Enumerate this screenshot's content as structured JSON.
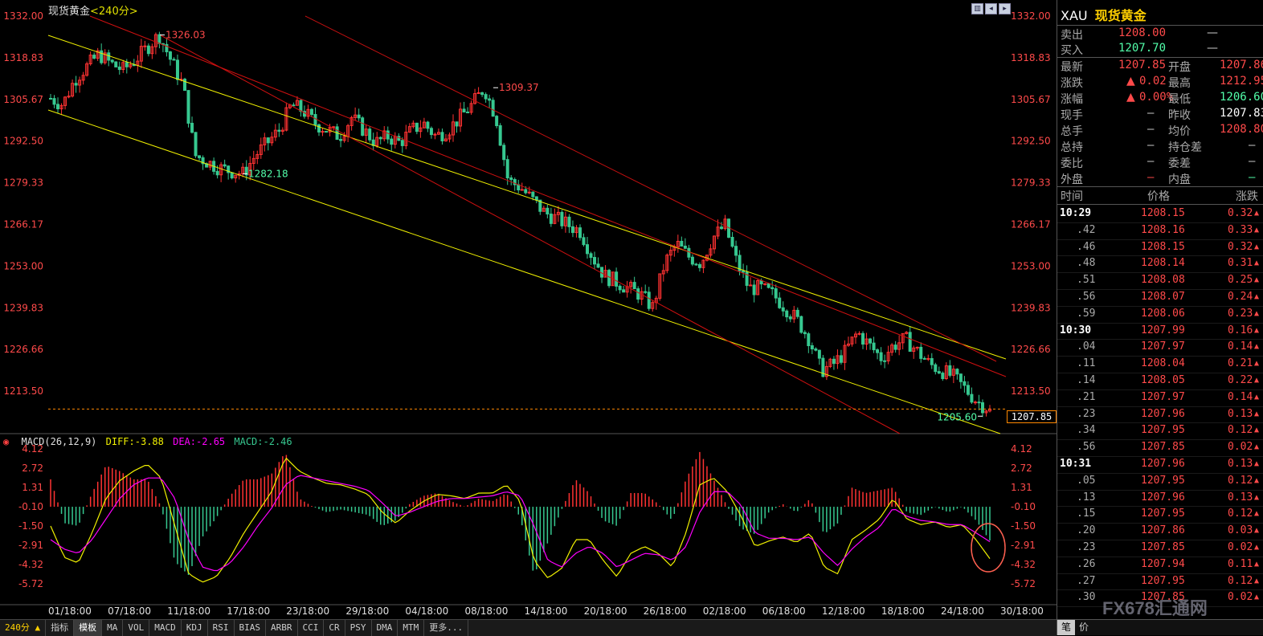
{
  "window": {
    "title": "现货黄金",
    "period": "<240分>",
    "toggle_icons": [
      "zoom-icon",
      "prev-icon",
      "next-icon"
    ]
  },
  "colors": {
    "up": "#ff3232",
    "down": "#36c890",
    "label_red": "#ff4a4a",
    "label_green": "#52ffaa",
    "trend_yellow": "#f0f000",
    "trend_red": "#d01010",
    "diff_line": "#f0f000",
    "dea_line": "#ff00ff",
    "price_cursor": "#ff8800"
  },
  "chart_data": [
    {
      "type": "candlestick",
      "title": "现货黄金<240分>",
      "yticks": [
        "1332.00",
        "1318.83",
        "1305.67",
        "1292.50",
        "1279.33",
        "1266.17",
        "1253.00",
        "1239.83",
        "1226.66",
        "1213.50"
      ],
      "ylim": [
        1200.34,
        1332.0
      ],
      "xticks": [
        "01/18:00",
        "07/18:00",
        "11/18:00",
        "17/18:00",
        "23/18:00",
        "29/18:00",
        "04/18:00",
        "08/18:00",
        "14/18:00",
        "20/18:00",
        "26/18:00",
        "02/18:00",
        "06/18:00",
        "12/18:00",
        "18/18:00",
        "24/18:00",
        "30/18:00"
      ],
      "annotations": [
        {
          "text": "1326.03",
          "value": 1326.03,
          "kind": "high"
        },
        {
          "text": "1282.18",
          "value": 1282.18,
          "kind": "low"
        },
        {
          "text": "1309.37",
          "value": 1309.37,
          "kind": "high"
        },
        {
          "text": "1205.60",
          "value": 1205.6,
          "kind": "low"
        }
      ],
      "current_price": "1207.85",
      "current_value": 1207.85,
      "price_path": [
        1306,
        1304,
        1312,
        1316,
        1320,
        1317,
        1315,
        1318,
        1322,
        1326.03,
        1318,
        1310,
        1288,
        1286,
        1284,
        1283,
        1282.18,
        1288,
        1292,
        1296,
        1304,
        1302,
        1298,
        1296,
        1294,
        1300,
        1296,
        1292,
        1294,
        1292,
        1296,
        1298,
        1294,
        1296,
        1300,
        1304,
        1309.37,
        1300,
        1280,
        1278,
        1274,
        1270,
        1268,
        1266,
        1264,
        1256,
        1250,
        1248,
        1246,
        1244,
        1240,
        1254,
        1260,
        1256,
        1254,
        1262,
        1266,
        1254,
        1246,
        1246,
        1244,
        1240,
        1236,
        1230,
        1220,
        1222,
        1226,
        1232,
        1228,
        1224,
        1228,
        1230,
        1226,
        1222,
        1220,
        1218,
        1214,
        1210,
        1207.85
      ],
      "trendlines": "two yellow descending channel lines and three red descending channel lines"
    },
    {
      "type": "macd",
      "indicator_name": "MACD(26,12,9)",
      "diff_label": "DIFF:",
      "diff": "-3.88",
      "dea_label": "DEA:",
      "dea": "-2.65",
      "macd_label": "MACD:",
      "macd": "-2.46",
      "yticks": [
        "4.12",
        "2.72",
        "1.31",
        "-0.10",
        "-1.50",
        "-2.91",
        "-4.32",
        "-5.72"
      ],
      "ylim": [
        -5.72,
        4.12
      ],
      "diff_path": [
        -1.5,
        -3.8,
        -4.2,
        -2.0,
        0.5,
        1.8,
        2.5,
        3.0,
        2.0,
        -1.5,
        -5.0,
        -5.6,
        -5.2,
        -3.8,
        -2.0,
        -0.5,
        1.0,
        3.5,
        2.5,
        2.0,
        1.6,
        1.5,
        1.2,
        0.8,
        -0.5,
        -1.3,
        -0.4,
        0.3,
        0.8,
        0.7,
        0.5,
        0.9,
        0.9,
        1.5,
        0.3,
        -4.0,
        -5.3,
        -4.6,
        -2.5,
        -2.5,
        -4.0,
        -5.2,
        -3.5,
        -3.0,
        -3.5,
        -4.5,
        -2.0,
        1.5,
        2.0,
        1.0,
        -0.8,
        -3.0,
        -2.6,
        -2.3,
        -2.7,
        -2.0,
        -4.5,
        -5.0,
        -2.5,
        -1.8,
        -1.0,
        0.5,
        -1.0,
        -1.4,
        -1.2,
        -1.6,
        -1.4,
        -2.5,
        -3.88
      ],
      "dea_path": [
        -2.5,
        -3.2,
        -3.5,
        -2.5,
        -1.0,
        0.5,
        1.5,
        2.0,
        2.0,
        0.5,
        -2.5,
        -4.5,
        -4.8,
        -4.2,
        -3.0,
        -1.5,
        -0.2,
        1.5,
        2.2,
        2.0,
        1.8,
        1.6,
        1.4,
        1.1,
        0.2,
        -0.8,
        -0.5,
        -0.1,
        0.3,
        0.5,
        0.5,
        0.6,
        0.7,
        1.0,
        0.7,
        -1.5,
        -4.0,
        -4.5,
        -3.5,
        -3.0,
        -3.5,
        -4.5,
        -4.0,
        -3.5,
        -3.6,
        -4.0,
        -3.0,
        -0.5,
        1.0,
        1.0,
        0.0,
        -2.0,
        -2.4,
        -2.4,
        -2.5,
        -2.3,
        -3.5,
        -4.4,
        -3.2,
        -2.3,
        -1.6,
        -0.2,
        -0.8,
        -1.1,
        -1.2,
        -1.4,
        -1.4,
        -2.0,
        -2.65
      ]
    }
  ],
  "right_panel": {
    "symbol": "XAU",
    "name": "现货黄金",
    "sell": {
      "label": "卖出",
      "price": "1208.00",
      "qty": "—"
    },
    "buy": {
      "label": "买入",
      "price": "1207.70",
      "qty": "—"
    },
    "stats": [
      {
        "label": "最新",
        "value": "1207.85",
        "label2": "开盘",
        "value2": "1207.86"
      },
      {
        "label": "涨跌",
        "value": "0.02",
        "arrow": "▲",
        "label2": "最高",
        "value2": "1212.95"
      },
      {
        "label": "涨幅",
        "value": "0.00%",
        "arrow": "▲",
        "label2": "最低",
        "value2": "1206.60"
      },
      {
        "label": "现手",
        "value": "—",
        "label2": "昨收",
        "value2": "1207.83"
      },
      {
        "label": "总手",
        "value": "—",
        "label2": "均价",
        "value2": "1208.80"
      },
      {
        "label": "总持",
        "value": "—",
        "label2": "持仓差",
        "value2": "—"
      },
      {
        "label": "委比",
        "value": "—",
        "label2": "委差",
        "value2": "—"
      },
      {
        "label": "外盘",
        "value": "—",
        "label2": "内盘",
        "value2": "—"
      }
    ],
    "tick_header": {
      "time": "时间",
      "price": "价格",
      "change": "涨跌"
    },
    "ticks": [
      {
        "time": "10:29",
        "price": "1208.15",
        "change": "0.32"
      },
      {
        "time": ".42",
        "price": "1208.16",
        "change": "0.33"
      },
      {
        "time": ".46",
        "price": "1208.15",
        "change": "0.32"
      },
      {
        "time": ".48",
        "price": "1208.14",
        "change": "0.31"
      },
      {
        "time": ".51",
        "price": "1208.08",
        "change": "0.25"
      },
      {
        "time": ".56",
        "price": "1208.07",
        "change": "0.24"
      },
      {
        "time": ".59",
        "price": "1208.06",
        "change": "0.23"
      },
      {
        "time": "10:30",
        "price": "1207.99",
        "change": "0.16"
      },
      {
        "time": ".04",
        "price": "1207.97",
        "change": "0.14"
      },
      {
        "time": ".11",
        "price": "1208.04",
        "change": "0.21"
      },
      {
        "time": ".14",
        "price": "1208.05",
        "change": "0.22"
      },
      {
        "time": ".21",
        "price": "1207.97",
        "change": "0.14"
      },
      {
        "time": ".23",
        "price": "1207.96",
        "change": "0.13"
      },
      {
        "time": ".34",
        "price": "1207.95",
        "change": "0.12"
      },
      {
        "time": ".56",
        "price": "1207.85",
        "change": "0.02"
      },
      {
        "time": "10:31",
        "price": "1207.96",
        "change": "0.13"
      },
      {
        "time": ".05",
        "price": "1207.95",
        "change": "0.12"
      },
      {
        "time": ".13",
        "price": "1207.96",
        "change": "0.13"
      },
      {
        "time": ".15",
        "price": "1207.95",
        "change": "0.12"
      },
      {
        "time": ".20",
        "price": "1207.86",
        "change": "0.03"
      },
      {
        "time": ".23",
        "price": "1207.85",
        "change": "0.02"
      },
      {
        "time": ".26",
        "price": "1207.94",
        "change": "0.11"
      },
      {
        "time": ".27",
        "price": "1207.95",
        "change": "0.12"
      },
      {
        "time": ".30",
        "price": "1207.85",
        "change": "0.02"
      }
    ],
    "bottom_tabs": [
      "笔",
      "价"
    ],
    "watermark": "FX678汇通网"
  },
  "toolbar": {
    "period": "240分",
    "items": [
      "指标",
      "模板",
      "MA",
      "VOL",
      "MACD",
      "KDJ",
      "RSI",
      "BIAS",
      "ARBR",
      "CCI",
      "CR",
      "PSY",
      "DMA",
      "MTM",
      "更多..."
    ]
  }
}
